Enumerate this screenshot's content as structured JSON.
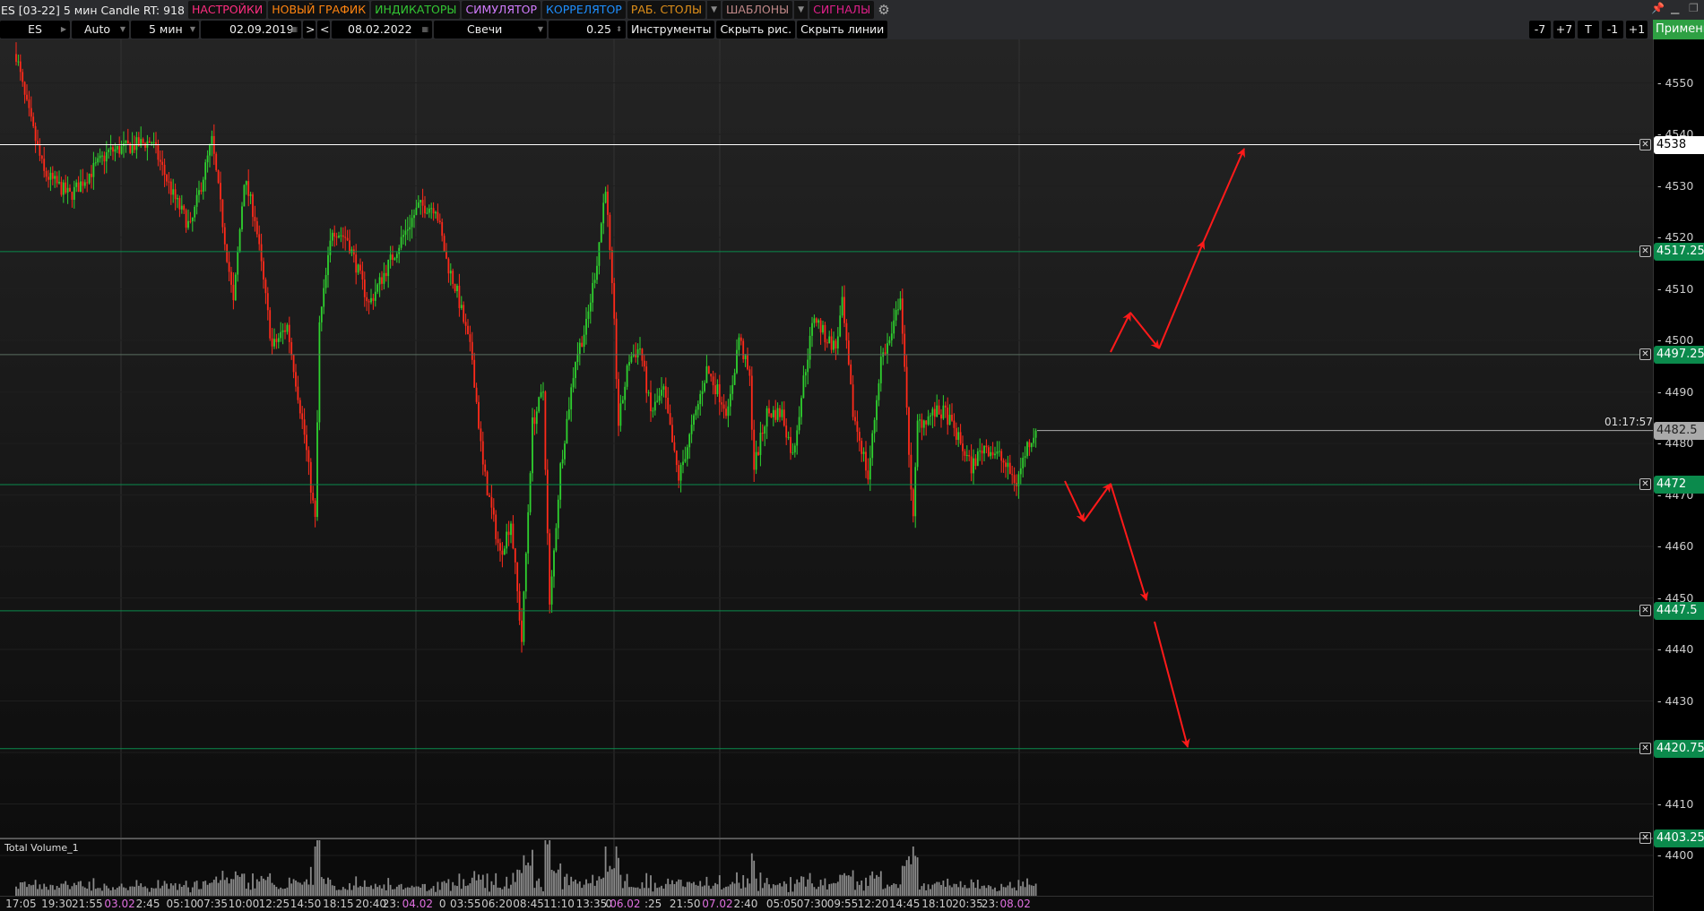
{
  "window": {
    "title": "ES [03-22] 5 мин Candle RT: 918"
  },
  "menu": [
    {
      "label": "НАСТРОЙКИ",
      "color": "#ff2d7f"
    },
    {
      "label": "НОВЫЙ ГРАФИК",
      "color": "#ff8410"
    },
    {
      "label": "ИНДИКАТОРЫ",
      "color": "#33c633"
    },
    {
      "label": "СИМУЛЯТОР",
      "color": "#d27cff"
    },
    {
      "label": "КОРРЕЛЯТОР",
      "color": "#1e8fff"
    },
    {
      "label": "РАБ. СТОЛЫ",
      "color": "#e0901a"
    },
    {
      "label": "ШАБЛОНЫ",
      "color": "#c08888"
    },
    {
      "label": "СИГНАЛЫ",
      "color": "#e0208a"
    }
  ],
  "toolbar": {
    "symbol": "ES",
    "scale": "Auto",
    "timeframe": "5 мин",
    "date_from": "02.09.2019",
    "next": ">",
    "prev": "<",
    "date_to": "08.02.2022",
    "chart_type": "Свечи",
    "step": "0.25",
    "tools": "Инструменты",
    "hide_drawings": "Скрыть рис.",
    "hide_lines": "Скрыть линии"
  },
  "right_buttons": [
    "-7",
    "+7",
    "T",
    "-1",
    "+1"
  ],
  "apply_label": "Применить",
  "price_axis": {
    "ticks": [
      4550,
      4540,
      4530,
      4520,
      4510,
      4500,
      4490,
      4480,
      4470,
      4460,
      4450,
      4440,
      4430,
      4420,
      4410,
      4400
    ]
  },
  "levels": [
    {
      "price": "4538",
      "type": "white"
    },
    {
      "price": "4517.25",
      "type": "green"
    },
    {
      "price": "4497.25",
      "type": "gray-green"
    },
    {
      "price": "4472",
      "type": "green"
    },
    {
      "price": "4447.5",
      "type": "green"
    },
    {
      "price": "4420.75",
      "type": "green"
    },
    {
      "price": "4403.25",
      "type": "gray"
    }
  ],
  "last_price": "4482.5",
  "bar_timer": "01:17:57",
  "volume_label": "Total Volume_1",
  "time_axis": [
    {
      "t": "17:05"
    },
    {
      "t": "19:30"
    },
    {
      "t": "21:55"
    },
    {
      "t": "03.02",
      "day": true
    },
    {
      "t": "2:45"
    },
    {
      "t": "05:10"
    },
    {
      "t": "07:35"
    },
    {
      "t": "10:00"
    },
    {
      "t": "12:25"
    },
    {
      "t": "14:50"
    },
    {
      "t": "18:15"
    },
    {
      "t": "20:40"
    },
    {
      "t": "23:"
    },
    {
      "t": "04.02",
      "day": true
    },
    {
      "t": "0"
    },
    {
      "t": "03:55"
    },
    {
      "t": "06:20"
    },
    {
      "t": "08:45"
    },
    {
      "t": "11:10"
    },
    {
      "t": "13:35"
    },
    {
      "t": "0"
    },
    {
      "t": "06.02",
      "day": true
    },
    {
      "t": ":25"
    },
    {
      "t": "21:50"
    },
    {
      "t": "07.02",
      "day": true
    },
    {
      "t": "2:40"
    },
    {
      "t": "05:05"
    },
    {
      "t": "07:30"
    },
    {
      "t": "09:55"
    },
    {
      "t": "12:20"
    },
    {
      "t": "14:45"
    },
    {
      "t": "18:10"
    },
    {
      "t": "20:35"
    },
    {
      "t": "23:"
    },
    {
      "t": "08.02",
      "day": true
    }
  ],
  "colors": {
    "up": "#2fd12f",
    "down": "#ff2a1a",
    "level_green": "#0b8a4c",
    "arrow": "#ff1a1a"
  },
  "chart_data": {
    "type": "candlestick",
    "bars": 475,
    "price_path": [
      [
        0,
        4555.6
      ],
      [
        4,
        4547.1
      ],
      [
        13,
        4532.4
      ],
      [
        25,
        4528.1
      ],
      [
        43,
        4536.6
      ],
      [
        63,
        4538.7
      ],
      [
        73,
        4528.1
      ],
      [
        81,
        4521.8
      ],
      [
        91,
        4538.7
      ],
      [
        99,
        4513.4
      ],
      [
        101,
        4507
      ],
      [
        106,
        4531.3
      ],
      [
        111,
        4523.9
      ],
      [
        119,
        4498.6
      ],
      [
        126,
        4502.8
      ],
      [
        134,
        4481.7
      ],
      [
        139,
        4464.9
      ],
      [
        141,
        4502.8
      ],
      [
        147,
        4521.8
      ],
      [
        154,
        4519.7
      ],
      [
        164,
        4507
      ],
      [
        174,
        4515.5
      ],
      [
        187,
        4526
      ],
      [
        195,
        4526
      ],
      [
        200,
        4515.5
      ],
      [
        205,
        4509.2
      ],
      [
        212,
        4496.5
      ],
      [
        217,
        4475.4
      ],
      [
        225,
        4458.5
      ],
      [
        230,
        4464.9
      ],
      [
        235,
        4441.7
      ],
      [
        240,
        4483.8
      ],
      [
        245,
        4490.2
      ],
      [
        248,
        4448
      ],
      [
        253,
        4475.4
      ],
      [
        260,
        4496.5
      ],
      [
        265,
        4502.8
      ],
      [
        270,
        4515.5
      ],
      [
        274,
        4530.2
      ],
      [
        278,
        4502.8
      ],
      [
        280,
        4483.8
      ],
      [
        285,
        4496.5
      ],
      [
        290,
        4498.6
      ],
      [
        295,
        4485.9
      ],
      [
        301,
        4490.2
      ],
      [
        306,
        4477.5
      ],
      [
        308,
        4473.3
      ],
      [
        316,
        4485.9
      ],
      [
        321,
        4494.4
      ],
      [
        326,
        4490.2
      ],
      [
        331,
        4485.9
      ],
      [
        336,
        4500.7
      ],
      [
        341,
        4492.3
      ],
      [
        343,
        4475.4
      ],
      [
        349,
        4485.9
      ],
      [
        356,
        4485.9
      ],
      [
        361,
        4477.5
      ],
      [
        366,
        4492.3
      ],
      [
        371,
        4504.9
      ],
      [
        376,
        4500.7
      ],
      [
        381,
        4498.6
      ],
      [
        384,
        4507
      ],
      [
        389,
        4485.9
      ],
      [
        394,
        4477.5
      ],
      [
        396,
        4473.3
      ],
      [
        402,
        4496.5
      ],
      [
        407,
        4500.7
      ],
      [
        411,
        4509.2
      ],
      [
        414,
        4485.9
      ],
      [
        417,
        4464.9
      ],
      [
        419,
        4483.8
      ],
      [
        427,
        4485.9
      ],
      [
        432,
        4485.9
      ],
      [
        437,
        4481.7
      ],
      [
        444,
        4475.4
      ],
      [
        450,
        4479.6
      ],
      [
        457,
        4477.5
      ],
      [
        465,
        4472.3
      ],
      [
        470,
        4479.6
      ],
      [
        474,
        4482.5
      ]
    ],
    "ylim": [
      4396,
      4560
    ]
  }
}
